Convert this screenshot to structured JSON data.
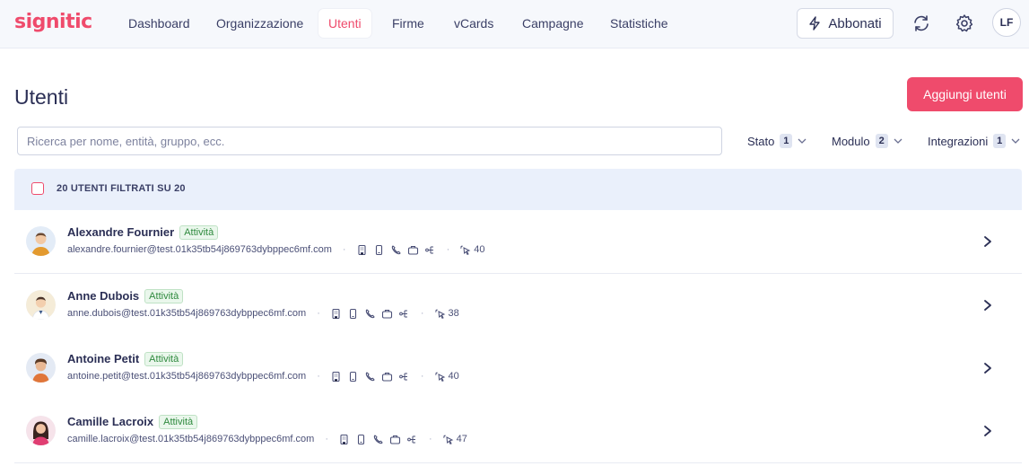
{
  "brand": {
    "logo": "signitic",
    "accent": "#ef4b6c"
  },
  "nav": {
    "items": [
      {
        "label": "Dashboard",
        "active": false
      },
      {
        "label": "Organizzazione",
        "active": false
      },
      {
        "label": "Utenti",
        "active": true
      },
      {
        "label": "Firme",
        "active": false
      },
      {
        "label": "vCards",
        "active": false
      },
      {
        "label": "Campagne",
        "active": false
      },
      {
        "label": "Statistiche",
        "active": false
      }
    ],
    "subscribe_label": "Abbonati",
    "refresh_icon": "refresh-icon",
    "settings_icon": "gear-icon",
    "user_initials": "LF"
  },
  "page": {
    "title": "Utenti",
    "add_button": "Aggiungi utenti"
  },
  "search": {
    "placeholder": "Ricerca per nome, entità, gruppo, ecc.",
    "value": ""
  },
  "filters": [
    {
      "label": "Stato",
      "count": "1"
    },
    {
      "label": "Modulo",
      "count": "2"
    },
    {
      "label": "Integrazioni",
      "count": "1"
    }
  ],
  "table": {
    "header_label": "20 UTENTI FILTRATI SU 20",
    "rows": [
      {
        "name": "Alexandre Fournier",
        "status": "Attività",
        "email": "alexandre.fournier@test.01k35tb54j869763dybppec6mf.com",
        "clicks": "40"
      },
      {
        "name": "Anne Dubois",
        "status": "Attività",
        "email": "anne.dubois@test.01k35tb54j869763dybppec6mf.com",
        "clicks": "38"
      },
      {
        "name": "Antoine Petit",
        "status": "Attività",
        "email": "antoine.petit@test.01k35tb54j869763dybppec6mf.com",
        "clicks": "40"
      },
      {
        "name": "Camille Lacroix",
        "status": "Attività",
        "email": "camille.lacroix@test.01k35tb54j869763dybppec6mf.com",
        "clicks": "47"
      }
    ]
  }
}
